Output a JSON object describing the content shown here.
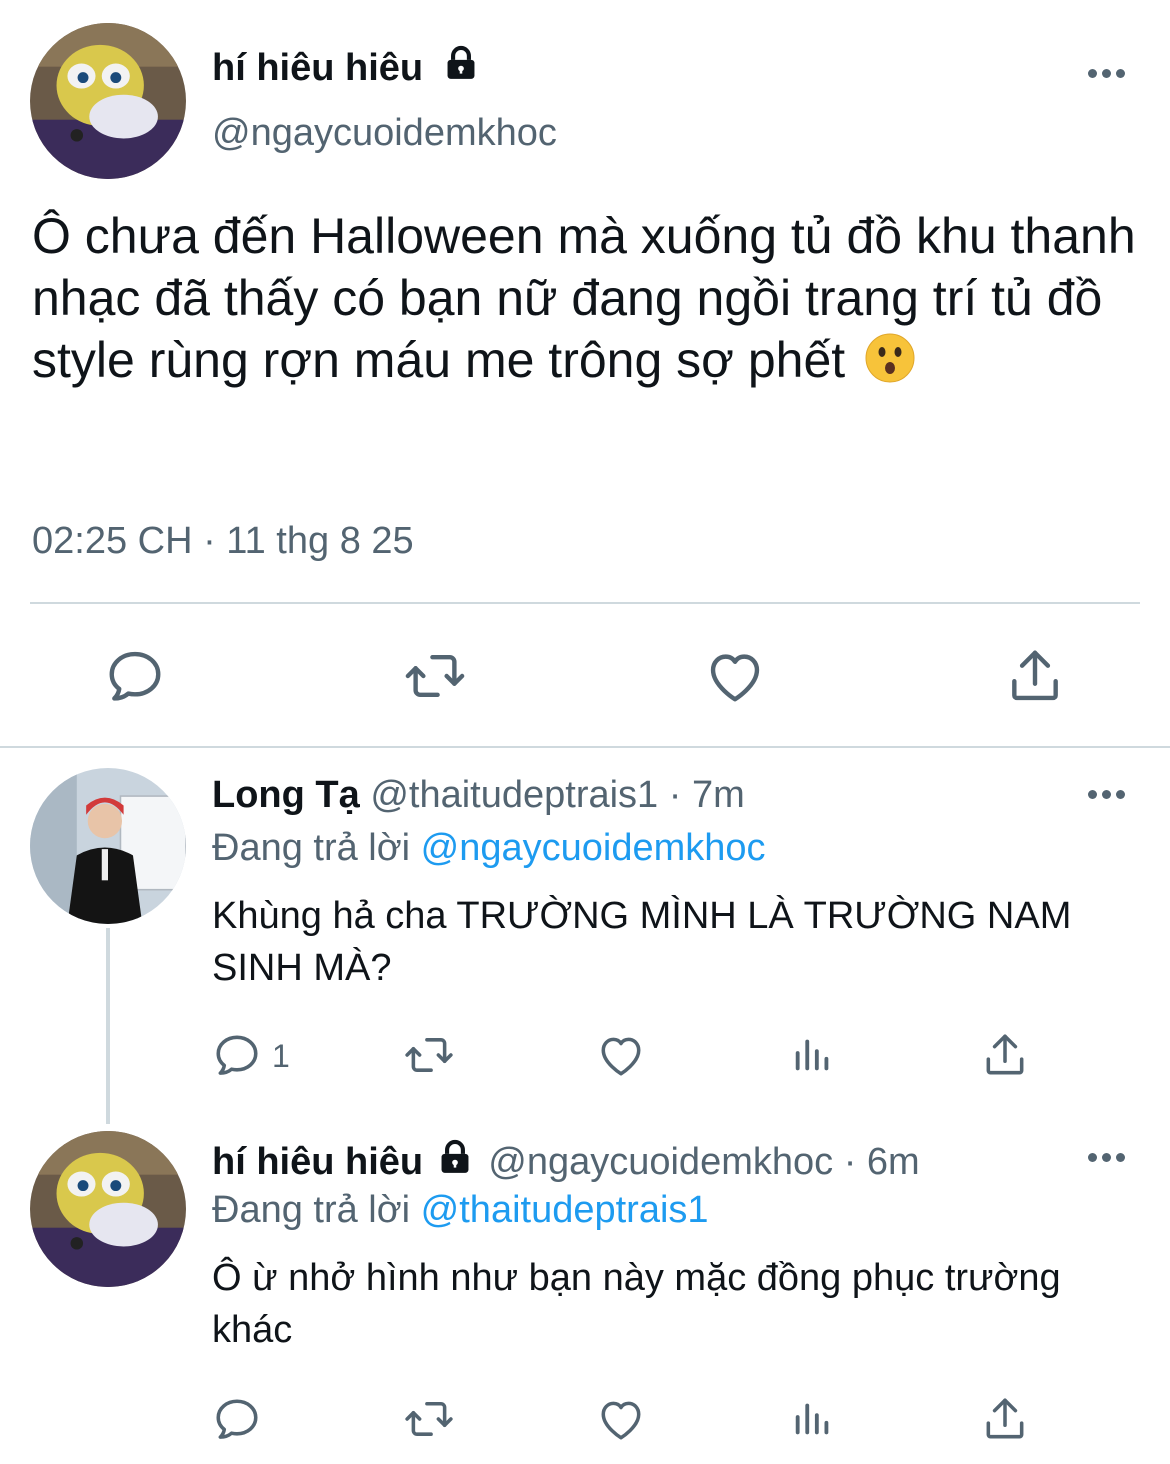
{
  "main_tweet": {
    "display_name": "hí hiêu hiêu",
    "handle": "@ngaycuoidemkhoc",
    "text": "Ô chưa đến Halloween mà xuống tủ đồ khu thanh nhạc đã thấy có bạn nữ đang ngồi trang trí tủ đồ style rùng rợn máu me trông sợ phết",
    "emoji": "hushed-face-emoji",
    "timestamp": "02:25 CH · 11 thg 8 25",
    "actions": [
      "reply-icon",
      "retweet-icon",
      "like-icon",
      "share-icon"
    ]
  },
  "replies": [
    {
      "display_name": "Long Tạ",
      "handle": "@thaitudeptrais1",
      "time": "· 7m",
      "reply_prefix": "Đang trả lời",
      "reply_to": "@ngaycuoidemkhoc",
      "text": "Khùng hả cha TRƯỜNG MÌNH LÀ TRƯỜNG NAM SINH MÀ?",
      "reply_count": "1",
      "actions": [
        "reply-icon",
        "retweet-icon",
        "like-icon",
        "analytics-icon",
        "share-icon"
      ]
    },
    {
      "display_name": "hí hiêu hiêu",
      "handle": "@ngaycuoidemkhoc",
      "time": "· 6m",
      "reply_prefix": "Đang trả lời",
      "reply_to": "@thaitudeptrais1",
      "text": "Ô ừ nhở hình như bạn này mặc đồng phục trường khác",
      "reply_count": "",
      "actions": [
        "reply-icon",
        "retweet-icon",
        "like-icon",
        "analytics-icon",
        "share-icon"
      ]
    }
  ],
  "colors": {
    "text": "#0f1419",
    "muted": "#536471",
    "link": "#1d9bf0",
    "divider": "#cfd9de"
  }
}
